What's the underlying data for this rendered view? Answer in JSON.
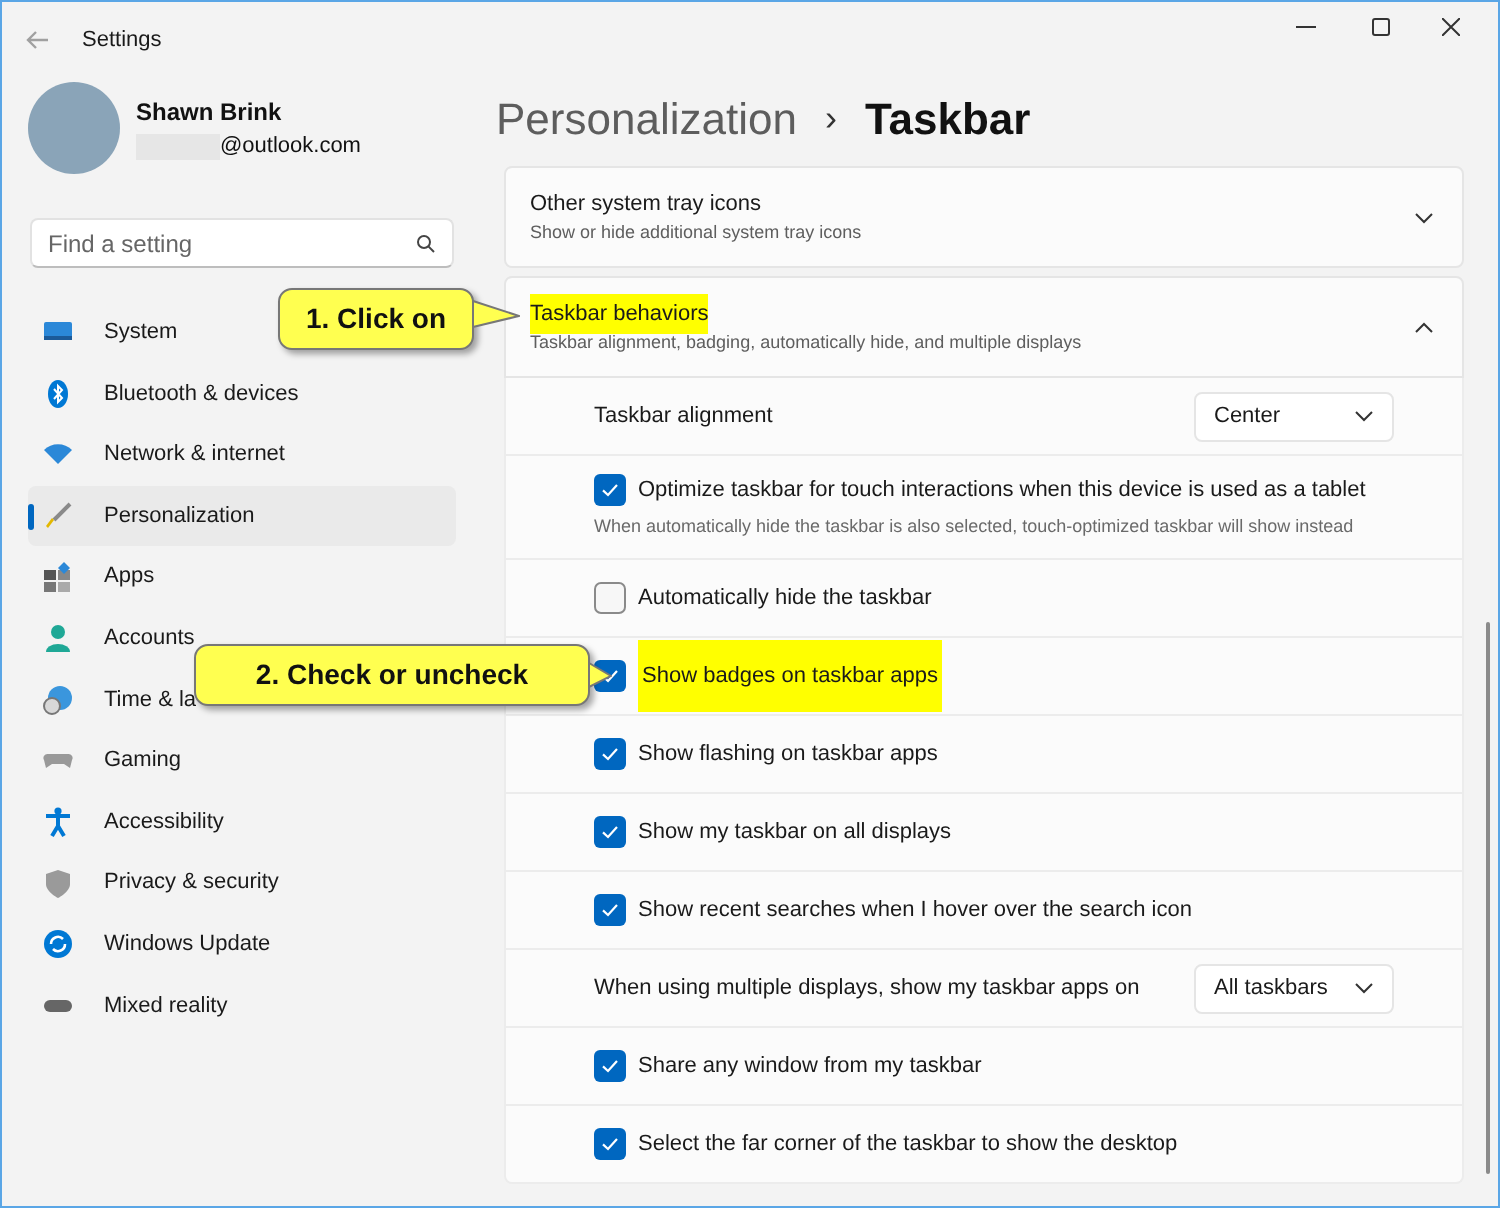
{
  "window": {
    "title": "Settings"
  },
  "profile": {
    "name": "Shawn Brink",
    "email": "@outlook.com"
  },
  "search": {
    "placeholder": "Find a setting"
  },
  "nav": [
    {
      "label": "System",
      "selected": false
    },
    {
      "label": "Bluetooth & devices",
      "selected": false
    },
    {
      "label": "Network & internet",
      "selected": false
    },
    {
      "label": "Personalization",
      "selected": true
    },
    {
      "label": "Apps",
      "selected": false
    },
    {
      "label": "Accounts",
      "selected": false
    },
    {
      "label": "Time & la",
      "selected": false
    },
    {
      "label": "Gaming",
      "selected": false
    },
    {
      "label": "Accessibility",
      "selected": false
    },
    {
      "label": "Privacy & security",
      "selected": false
    },
    {
      "label": "Windows Update",
      "selected": false
    },
    {
      "label": "Mixed reality",
      "selected": false
    }
  ],
  "breadcrumb": {
    "parent": "Personalization",
    "separator": "›",
    "current": "Taskbar"
  },
  "cards": [
    {
      "title": "Other system tray icons",
      "subtitle": "Show or hide additional system tray icons",
      "expanded": false,
      "highlighted": false
    },
    {
      "title": "Taskbar behaviors",
      "subtitle": "Taskbar alignment, badging, automatically hide, and multiple displays",
      "expanded": true,
      "highlighted": true,
      "settings": [
        {
          "kind": "dropdown",
          "label": "Taskbar alignment",
          "value": "Center"
        },
        {
          "kind": "checkbox",
          "label": "Optimize taskbar for touch interactions when this device is used as a tablet",
          "description": "When automatically hide the taskbar is also selected, touch-optimized taskbar will show instead",
          "checked": true,
          "highlighted": false
        },
        {
          "kind": "checkbox",
          "label": "Automatically hide the taskbar",
          "checked": false,
          "highlighted": false
        },
        {
          "kind": "checkbox",
          "label": "Show badges on taskbar apps",
          "checked": true,
          "highlighted": true
        },
        {
          "kind": "checkbox",
          "label": "Show flashing on taskbar apps",
          "checked": true,
          "highlighted": false
        },
        {
          "kind": "checkbox",
          "label": "Show my taskbar on all displays",
          "checked": true,
          "highlighted": false
        },
        {
          "kind": "checkbox",
          "label": "Show recent searches when I hover over the search icon",
          "checked": true,
          "highlighted": false
        },
        {
          "kind": "dropdown",
          "label": "When using multiple displays, show my taskbar apps on",
          "value": "All taskbars"
        },
        {
          "kind": "checkbox",
          "label": "Share any window from my taskbar",
          "checked": true,
          "highlighted": false
        },
        {
          "kind": "checkbox",
          "label": "Select the far corner of the taskbar to show the desktop",
          "checked": true,
          "highlighted": false
        }
      ]
    }
  ],
  "callouts": [
    {
      "text": "1. Click on"
    },
    {
      "text": "2. Check or uncheck"
    }
  ]
}
